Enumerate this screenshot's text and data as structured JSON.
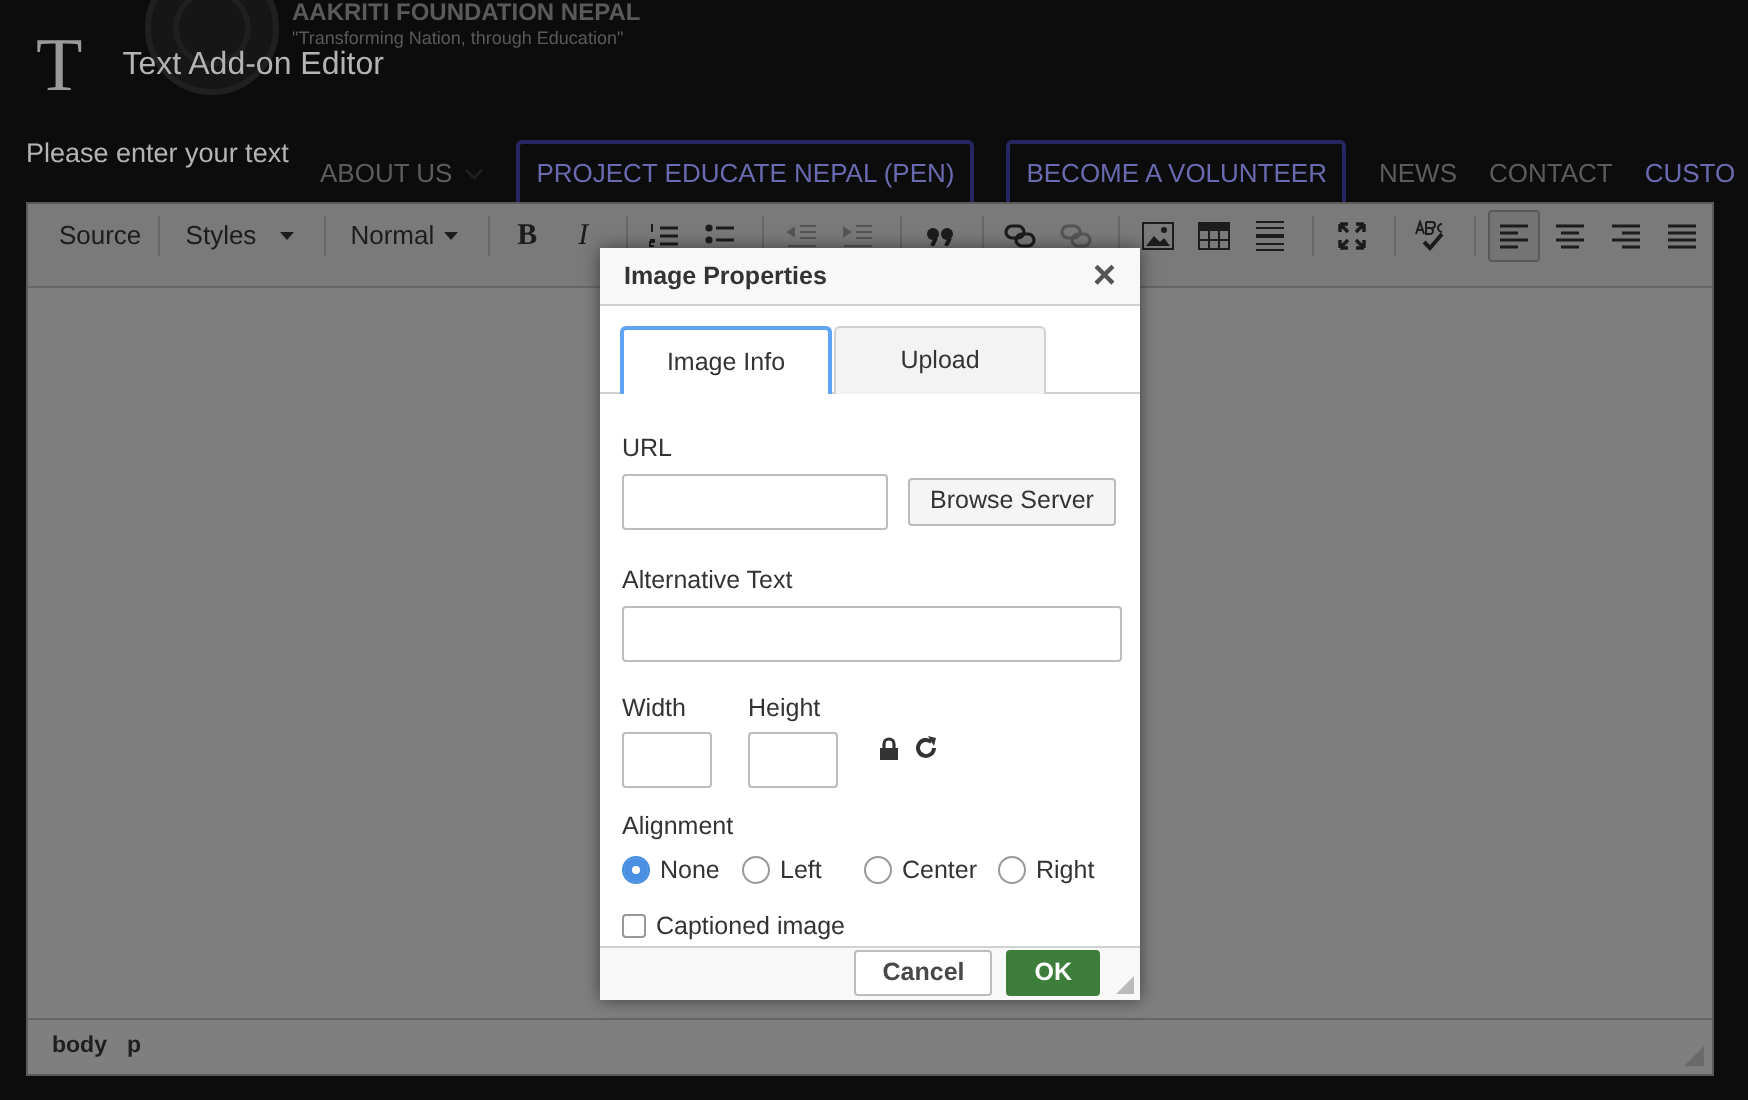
{
  "backdrop_site": {
    "logo_title": "AAKRITI FOUNDATION NEPAL",
    "logo_tagline": "\"Transforming Nation, through Education\"",
    "nav": [
      {
        "label": "ABOUT US",
        "kind": "dropdown"
      },
      {
        "label": "PROJECT EDUCATE NEPAL (PEN)",
        "kind": "outlined"
      },
      {
        "label": "BECOME A VOLUNTEER",
        "kind": "outlined"
      },
      {
        "label": "NEWS",
        "kind": "link"
      },
      {
        "label": "CONTACT",
        "kind": "link"
      },
      {
        "label": "CUSTO",
        "kind": "faded"
      }
    ]
  },
  "panel": {
    "icon": "T",
    "title": "Text Add-on Editor",
    "prompt": "Please enter your text"
  },
  "toolbar": [
    {
      "kind": "source",
      "label": "Source",
      "selected": false
    },
    {
      "kind": "separator"
    },
    {
      "kind": "combo",
      "label": "Styles"
    },
    {
      "kind": "separator"
    },
    {
      "kind": "combo",
      "label": "Normal"
    },
    {
      "kind": "separator"
    },
    {
      "kind": "bold",
      "label": "B",
      "selected": false
    },
    {
      "kind": "italic",
      "label": "I",
      "selected": false
    },
    {
      "kind": "separator"
    },
    {
      "kind": "numbered",
      "selected": false
    },
    {
      "kind": "bulleted",
      "selected": false
    },
    {
      "kind": "separator"
    },
    {
      "kind": "outdent",
      "selected": false
    },
    {
      "kind": "indent",
      "selected": false
    },
    {
      "kind": "separator"
    },
    {
      "kind": "blockquote",
      "selected": false
    },
    {
      "kind": "separator"
    },
    {
      "kind": "link",
      "selected": false
    },
    {
      "kind": "unlink",
      "selected": false
    },
    {
      "kind": "separator"
    },
    {
      "kind": "image",
      "selected": false
    },
    {
      "kind": "table",
      "selected": false
    },
    {
      "kind": "rule",
      "selected": false
    },
    {
      "kind": "separator"
    },
    {
      "kind": "maximize",
      "selected": false
    },
    {
      "kind": "separator"
    },
    {
      "kind": "spellcheck",
      "selected": false
    },
    {
      "kind": "separator"
    },
    {
      "kind": "alignleft",
      "selected": true
    },
    {
      "kind": "aligncenter",
      "selected": false
    },
    {
      "kind": "alignright",
      "selected": false
    },
    {
      "kind": "alignjustify",
      "selected": false
    }
  ],
  "element_path": [
    "body",
    "p"
  ],
  "dialog": {
    "title": "Image Properties",
    "close": "×",
    "tabs": [
      {
        "label": "Image Info",
        "selected": true
      },
      {
        "label": "Upload",
        "selected": false
      }
    ],
    "url_label": "URL",
    "browse_button": "Browse Server",
    "alt_label": "Alternative Text",
    "width_label": "Width",
    "height_label": "Height",
    "alignment_label": "Alignment",
    "alignments": [
      {
        "label": "None",
        "selected": true
      },
      {
        "label": "Left",
        "selected": false
      },
      {
        "label": "Center",
        "selected": false
      },
      {
        "label": "Right",
        "selected": false
      }
    ],
    "caption": {
      "label": "Captioned image",
      "checked": false
    },
    "buttons": [
      {
        "label": "Cancel",
        "kind": "secondary"
      },
      {
        "label": "OK",
        "kind": "primary"
      }
    ]
  }
}
